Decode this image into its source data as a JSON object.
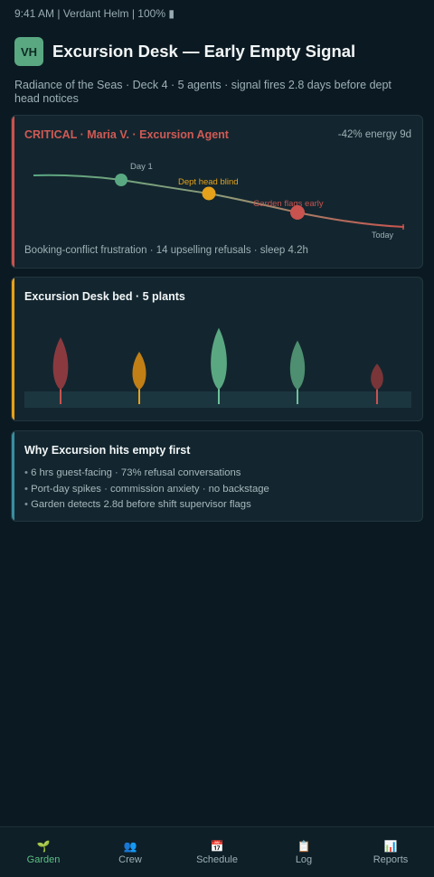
{
  "status_bar": {
    "text": "9:41 AM | Verdant Helm | 100% ▮"
  },
  "header": {
    "avatar": "VH",
    "title": "Excursion Desk — Early Empty Signal",
    "subtitle": "Radiance of the Seas · Deck 4 · 5 agents · signal fires 2.8 days before dept head notices"
  },
  "alert_card": {
    "title": "CRITICAL · Maria V. · Excursion Agent",
    "energy": "-42% energy 9d",
    "labels": {
      "day1": "Day 1",
      "blind": "Dept head blind",
      "flags": "Garden flags early",
      "today": "Today"
    },
    "footer": "Booking-conflict frustration · 14 upselling refusals · sleep 4.2h",
    "colors": {
      "start": "#5aa882",
      "mid": "#e6a21a",
      "end": "#c9534f"
    }
  },
  "bed_card": {
    "title": "Excursion Desk bed · 5 plants",
    "plants": [
      {
        "color": "#8a3a3f",
        "stem": "#c9534f",
        "level": 0.68
      },
      {
        "color": "#c17f16",
        "stem": "#e6a21a",
        "level": 0.5
      },
      {
        "color": "#5aa882",
        "stem": "#6cc298",
        "level": 0.8
      },
      {
        "color": "#4d8f70",
        "stem": "#6cc298",
        "level": 0.64
      },
      {
        "color": "#7a3538",
        "stem": "#c9534f",
        "level": 0.35
      }
    ]
  },
  "why_card": {
    "title": "Why Excursion hits empty first",
    "bullets": [
      "6 hrs guest-facing · 73% refusal conversations",
      "Port-day spikes · commission anxiety · no backstage",
      "Garden detects 2.8d before shift supervisor flags"
    ]
  },
  "nav": [
    {
      "icon": "🌱",
      "label": "Garden",
      "active": true
    },
    {
      "icon": "👥",
      "label": "Crew",
      "active": false
    },
    {
      "icon": "📅",
      "label": "Schedule",
      "active": false
    },
    {
      "icon": "📋",
      "label": "Log",
      "active": false
    },
    {
      "icon": "📊",
      "label": "Reports",
      "active": false
    }
  ]
}
